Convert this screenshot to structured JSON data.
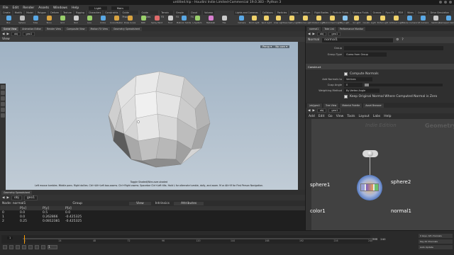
{
  "window": {
    "title": "untitled.hip - Houdini Indie Limited-Commercial 19.0.383 - Python 3"
  },
  "menu": [
    "File",
    "Edit",
    "Render",
    "Assets",
    "Windows",
    "Help"
  ],
  "desktop": {
    "label": "Light",
    "context": "Main"
  },
  "shelf_left": {
    "tabs": [
      "Create",
      "Modify",
      "Model",
      "Polygon",
      "Deform",
      "Texture",
      "Rigging",
      "Characters",
      "Constraints",
      "Guide Process",
      "Guide Brushes",
      "Terrain FX",
      "Simple FX",
      "Cloud FX",
      "Volume"
    ],
    "tools": [
      {
        "label": "Box",
        "color": "#5aa9e6"
      },
      {
        "label": "Sphere",
        "color": "#bdbdbd"
      },
      {
        "label": "Tube",
        "color": "#5aa9e6"
      },
      {
        "label": "Torus",
        "color": "#d9a441"
      },
      {
        "label": "Grid",
        "color": "#9ad06b"
      },
      {
        "label": "Null",
        "color": "#cccccc"
      },
      {
        "label": "Line",
        "color": "#9ad06b"
      },
      {
        "label": "Circle",
        "color": "#5aa9e6"
      },
      {
        "label": "Curve Bezier",
        "color": "#d9a441"
      },
      {
        "label": "Draw Curve",
        "color": "#d9a441"
      },
      {
        "label": "Path",
        "color": "#9ad06b"
      },
      {
        "label": "Spray Paint",
        "color": "#e06b6b"
      },
      {
        "label": "Font",
        "color": "#cccccc"
      },
      {
        "label": "Platonic Solids",
        "color": "#5aa9e6"
      },
      {
        "label": "L-System",
        "color": "#9ad06b"
      },
      {
        "label": "Metaball",
        "color": "#d97fd0"
      },
      {
        "label": "File",
        "color": "#cccccc"
      }
    ]
  },
  "shelf_right": {
    "tabs": [
      "Lights and Cameras",
      "Collisions",
      "Particles",
      "Grains",
      "Vellum",
      "Rigid Bodies",
      "Particle Fluids",
      "Viscous Fluids",
      "Oceans",
      "Pyro FX",
      "FEM",
      "Wires",
      "Crowds",
      "Drive Simulation"
    ],
    "tools": [
      {
        "label": "Camera",
        "color": "#5aa9e6"
      },
      {
        "label": "Point Light",
        "color": "#f0d26b"
      },
      {
        "label": "Spot Light",
        "color": "#f0d26b"
      },
      {
        "label": "Area Light",
        "color": "#f0d26b"
      },
      {
        "label": "Geometry Light",
        "color": "#f0d26b"
      },
      {
        "label": "Volume Light",
        "color": "#f0d26b"
      },
      {
        "label": "Distant Light",
        "color": "#f0d26b"
      },
      {
        "label": "Environment Light",
        "color": "#f0d26b"
      },
      {
        "label": "Sky Light",
        "color": "#8ac6f0"
      },
      {
        "label": "GI Light",
        "color": "#f0d26b"
      },
      {
        "label": "Caustic Light",
        "color": "#f0d26b"
      },
      {
        "label": "Portal Light",
        "color": "#f0d26b"
      },
      {
        "label": "Ambient Light",
        "color": "#f0d26b"
      },
      {
        "label": "Stereo Camera",
        "color": "#5aa9e6"
      },
      {
        "label": "VR Camera",
        "color": "#5aa9e6"
      },
      {
        "label": "Switcher",
        "color": "#cccccc"
      },
      {
        "label": "Gamepad Camera",
        "color": "#5aa9e6"
      }
    ]
  },
  "left_tabs": [
    "Scene View",
    "Animation Editor",
    "Render View",
    "Composite View",
    "Motion FX View",
    "Geometry Spreadsheet"
  ],
  "left_path": {
    "root": "obj",
    "node": "geo1"
  },
  "viewport": {
    "tab": "View",
    "persp": "Persp ▾",
    "cam": "No cam ▾",
    "status_line1": "Toggle Shaded/Wire-over-shaded",
    "status_line2": "Left mouse tumbles. Middle pans. Right dollies. Ctrl+Alt+Left box-zooms. Ctrl+Right zooms. Spacebar Ctrl+Left tilts. Hold L for alternate tumble, dolly, and zoom.    M or Alt+M for First Person Navigation."
  },
  "spreadsheet": {
    "tab": "Geometry Spreadsheet",
    "path_root": "obj",
    "path_node": "geo1",
    "node_label": "Node: normal1",
    "group_label": "Group",
    "view_label": "View",
    "intrinsics_label": "Intrinsics",
    "attributes_label": "Attributes",
    "columns": [
      "",
      "P[x]",
      "P[y]",
      "P[z]"
    ],
    "rows": [
      [
        "0",
        "0.0",
        "0.5",
        "0.0"
      ],
      [
        "1",
        "0.0",
        "0.262866",
        "-0.425325"
      ],
      [
        "2",
        "0.25",
        "0.0812381",
        "-0.425325"
      ]
    ]
  },
  "params": {
    "tabs": [
      "normal1",
      "Take List",
      "Performance Monitor"
    ],
    "path_root": "obj",
    "path_node": "geo1",
    "node_type": "Normal",
    "node_name": "normal1",
    "group_label": "Group",
    "group_type_label": "Group Type",
    "group_type_value": "Guess from Group",
    "section": "Construct",
    "compute_normals": "Compute Normals",
    "add_normals_label": "Add Normals to",
    "add_normals_value": "Vertices",
    "cusp_label": "Cusp Angle",
    "cusp_value": "0",
    "weighting_label": "Weighting Method",
    "weighting_value": "By Vertex Angle",
    "keep_original": "Keep Original Normal Where Computed Normal is Zero"
  },
  "network": {
    "tabs": [
      "/obj/geo1",
      "Tree View",
      "Material Palette",
      "Asset Browser"
    ],
    "path_root": "obj",
    "path_node": "geo1",
    "menu": [
      "Add",
      "Edit",
      "Go",
      "View",
      "Tools",
      "Layout",
      "Labs",
      "Help"
    ],
    "watermark_context": "Indie Edition",
    "watermark_type": "Geometry",
    "side_label_1": "sphere1",
    "side_label_2": "color1",
    "node1": "sphere2",
    "node2": "normal1"
  },
  "playbar": {
    "frame": "1",
    "ticks": [
      "1",
      "24",
      "48",
      "72",
      "96",
      "120",
      "144",
      "168",
      "192",
      "216",
      "240"
    ],
    "start": "1",
    "end": "240",
    "keys_label": "0 keys, 0/0 channels",
    "key_all": "Key All Channels",
    "auto_update": "Auto Update"
  }
}
